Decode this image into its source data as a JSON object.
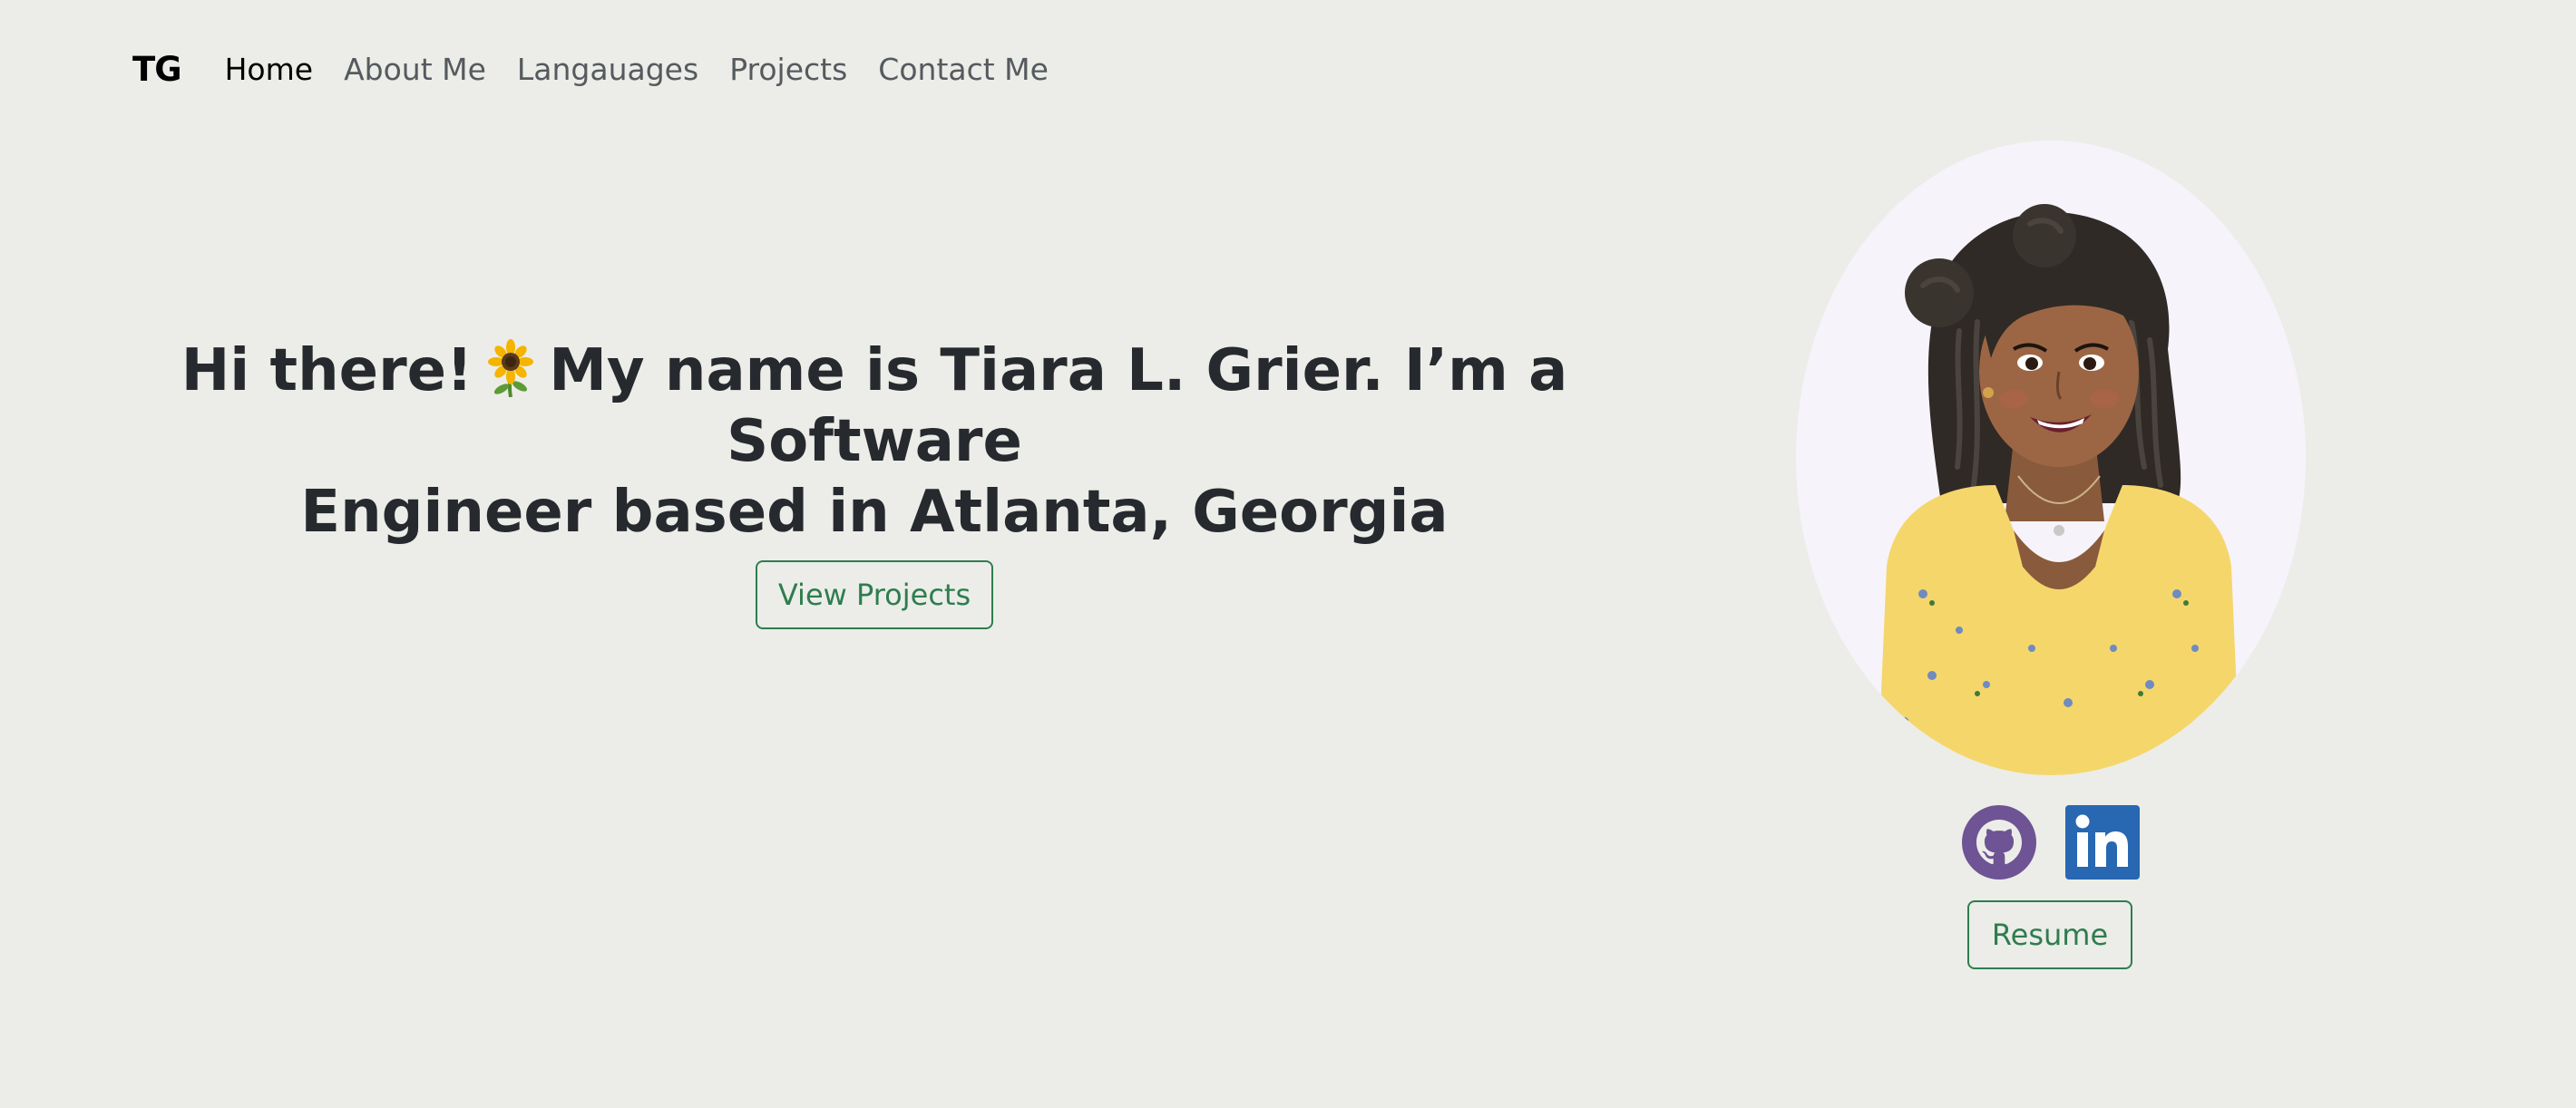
{
  "brand": "TG",
  "nav": {
    "items": [
      {
        "label": "Home",
        "active": true
      },
      {
        "label": "About Me",
        "active": false
      },
      {
        "label": "Langauages",
        "active": false
      },
      {
        "label": "Projects",
        "active": false
      },
      {
        "label": "Contact Me",
        "active": false
      }
    ]
  },
  "hero": {
    "greeting": "Hi there!",
    "greeting_icon": "sunflower-emoji",
    "title_rest_line1": "My name is Tiara L. Grier. I’m a Software",
    "title_rest_line2": "Engineer based in Atlanta, Georgia",
    "cta_label": "View Projects"
  },
  "profile": {
    "avatar_icon": "cartoon-avatar",
    "social": [
      {
        "icon": "github-icon",
        "color": "#6e5494"
      },
      {
        "icon": "linkedin-icon",
        "color": "#2867b2"
      }
    ],
    "resume_label": "Resume"
  },
  "colors": {
    "background": "#ecede8",
    "accent_green": "#2e7d4f",
    "text_dark": "#262a2e",
    "nav_muted": "#555a5e",
    "avatar_bg": "#f6f3fb"
  }
}
